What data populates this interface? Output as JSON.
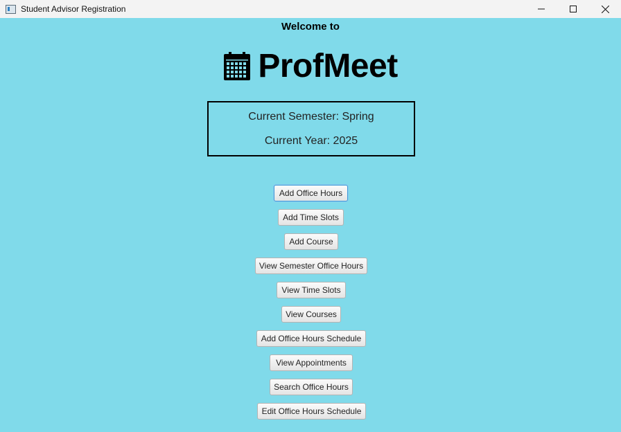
{
  "window": {
    "title": "Student Advisor Registration",
    "icon": "app-window-icon",
    "controls": [
      "minimize-icon",
      "maximize-icon",
      "close-icon"
    ]
  },
  "header": {
    "welcome": "Welcome to",
    "brand_icon": "calendar-icon",
    "brand_name": "ProfMeet"
  },
  "semester_info": {
    "semester": "Current Semester: Spring",
    "year": "Current Year: 2025"
  },
  "buttons": [
    {
      "label": "Add Office Hours",
      "focused": true
    },
    {
      "label": "Add Time Slots"
    },
    {
      "label": "Add Course"
    },
    {
      "label": "View Semester Office Hours"
    },
    {
      "label": "View Time Slots"
    },
    {
      "label": "View Courses"
    },
    {
      "label": "Add Office Hours Schedule"
    },
    {
      "label": "View Appointments"
    },
    {
      "label": "Search Office Hours"
    },
    {
      "label": "Edit Office Hours Schedule"
    }
  ],
  "colors": {
    "background": "#80daea",
    "focus_border": "#3c9ad6"
  }
}
